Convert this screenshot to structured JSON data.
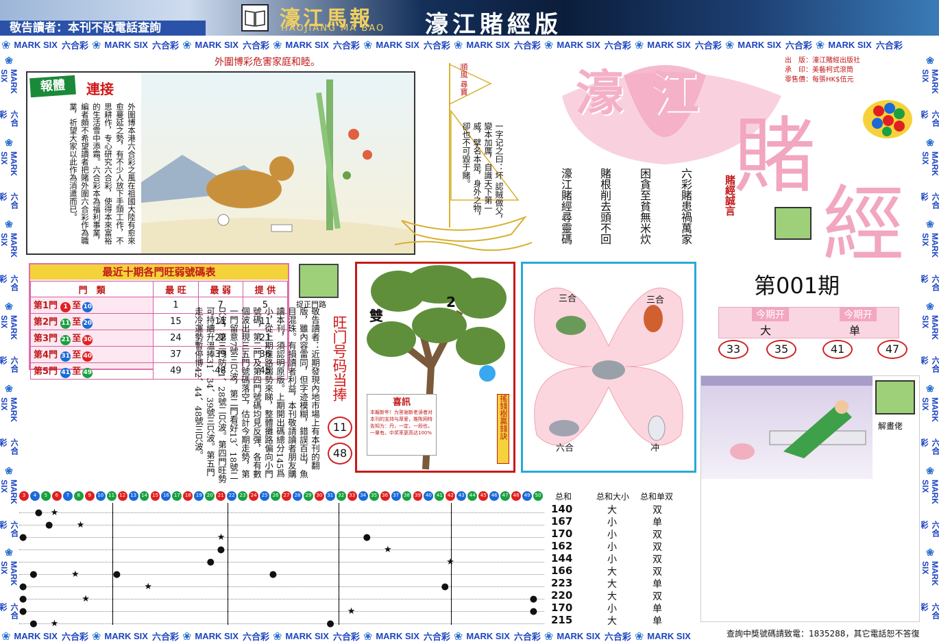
{
  "header": {
    "warning": "敬告讀者：本刊不設電話查詢",
    "mag_title": "濠江馬報",
    "mag_sub": "HAOJIANG MA BAO",
    "edition": "濠江賭經版"
  },
  "ribbon": {
    "cn": "六合彩",
    "en": "MARK SIX"
  },
  "top_caption": "外圍博彩危害家庭和睦。",
  "story": {
    "badge": "報體",
    "badge2": "連接",
    "text": "外圍博本港六合彩之風在祖國大陸有愈來愈蔓延之勢，有不少人放下手頭工作，不思耕作，专心研究六合彩，使得本來富裕的生活雪中添霜。六合彩本為福利事業，編者頗不希望讀者把賭外圍六合彩作為職業，祈望大家以此作為消遣而已。"
  },
  "poem": {
    "flag": "順風 尋寶",
    "text": "一字记之曰：坏 認賊做父，變本加厲，自識天下第一威，擘名本是，身外之物，卻也不可毀于賭。"
  },
  "big_title": {
    "chars": [
      "濠",
      "江",
      "賭",
      "經"
    ],
    "motto": "賭經誠言"
  },
  "pub_info": [
    {
      "k": "出　版：",
      "v": "濠江賭經出版社"
    },
    {
      "k": "承　印：",
      "v": "美藝柯式滾筒"
    },
    {
      "k": "零售價：",
      "v": "每張HK$伍元"
    }
  ],
  "proverbs": [
    "六彩賭患禍萬家",
    "困貪至貧無米炊",
    "賭根削去頭不回",
    "濠江賭經尋靈碼"
  ],
  "issue": "第001期",
  "today": {
    "label1": "今期开",
    "v1": "大",
    "label2": "今期开",
    "v2": "单",
    "nums": [
      "33",
      "35",
      "41",
      "47"
    ]
  },
  "table": {
    "title": "最近十期各門旺弱號碼表",
    "headers": [
      "門　類",
      "最 旺",
      "最 弱",
      "提 供"
    ],
    "rows": [
      {
        "gate": "第1門",
        "a": "1",
        "b": "10",
        "hot": "1",
        "cold": "7",
        "give": "5",
        "ca": "#e02020",
        "cb": "#1a6ad8"
      },
      {
        "gate": "第2門",
        "a": "11",
        "b": "20",
        "hot": "15",
        "cold": "11",
        "give": "11",
        "ca": "#1aa040",
        "cb": "#1a6ad8"
      },
      {
        "gate": "第3門",
        "a": "21",
        "b": "30",
        "hot": "24",
        "cold": "22",
        "give": "21",
        "ca": "#1aa040",
        "cb": "#e02020"
      },
      {
        "gate": "第4門",
        "a": "31",
        "b": "40",
        "hot": "37",
        "cold": "39",
        "give": "36",
        "ca": "#1a6ad8",
        "cb": "#e02020"
      },
      {
        "gate": "第5門",
        "a": "41",
        "b": "49",
        "hot": "49",
        "cold": "48",
        "give": "45",
        "ca": "#1a6ad8",
        "cb": "#1aa040"
      }
    ],
    "to": "至"
  },
  "gate_tip": {
    "caption": "捉正門路",
    "text": "敬告讀者：近期發現內地市場上有本刊的翻版，雖內容雷同，但字迹模糊，錯誤百出，魚目混珠。有損讀者利益，本刊敬請讀者朋友購讀本刊，須認明原版。上期開出碼總分145爲小，從上期推路趨勢來睇，整體攤路偏向小門號碼，第二門及第四門號碼均見反彈，各有數個波出現三五門號碼落空，估計今期走勢，第一門留意7號三只波，第二門看好13、18號二只波，第三門防21、28號二只波。第四門旺勢可持續升溫捧31、34、39號三只波。第五門走冷運勢暫停博42、44、48號三只波。"
  },
  "hot_gate": {
    "text": "旺门号码当捧",
    "n1": "11",
    "n2": "48"
  },
  "tree": {
    "label": "雙",
    "num": "2",
    "news_title": "喜訊",
    "news_text": "本報新年！为答谢新老读者对本刊的支持与厚爱，推陈网特告知为：丹，一定，一段也，一單有。中奖率更高达100%",
    "side": "搖錢樹贏錢訣"
  },
  "zodiac": {
    "tl": "三合",
    "tr": "三合",
    "bl": "六合",
    "br": "冲"
  },
  "cartoon": {
    "caption": "解畫佬"
  },
  "grid": {
    "numbers": [
      "3",
      "4",
      "5",
      "6",
      "7",
      "8",
      "9",
      "10",
      "11",
      "12",
      "13",
      "14",
      "15",
      "16",
      "17",
      "18",
      "19",
      "20",
      "21",
      "22",
      "23",
      "24",
      "25",
      "26",
      "27",
      "28",
      "29",
      "30",
      "31",
      "32",
      "33",
      "34",
      "35",
      "36",
      "37",
      "38",
      "39",
      "40",
      "41",
      "42",
      "43",
      "44",
      "45",
      "46",
      "47",
      "48",
      "49",
      "50"
    ],
    "headers": [
      "总和",
      "总和大小",
      "总和单双"
    ],
    "rows": [
      {
        "sum": "140",
        "size": "大",
        "parity": "双"
      },
      {
        "sum": "167",
        "size": "小",
        "parity": "单"
      },
      {
        "sum": "170",
        "size": "小",
        "parity": "双"
      },
      {
        "sum": "162",
        "size": "小",
        "parity": "双"
      },
      {
        "sum": "144",
        "size": "小",
        "parity": "双"
      },
      {
        "sum": "166",
        "size": "大",
        "parity": "双"
      },
      {
        "sum": "223",
        "size": "大",
        "parity": "单"
      },
      {
        "sum": "220",
        "size": "大",
        "parity": "双"
      },
      {
        "sum": "170",
        "size": "小",
        "parity": "单"
      },
      {
        "sum": "215",
        "size": "大",
        "parity": "单"
      }
    ]
  },
  "footer": "查詢中獎號碼請致電：1835288，其它電話恕不答復"
}
